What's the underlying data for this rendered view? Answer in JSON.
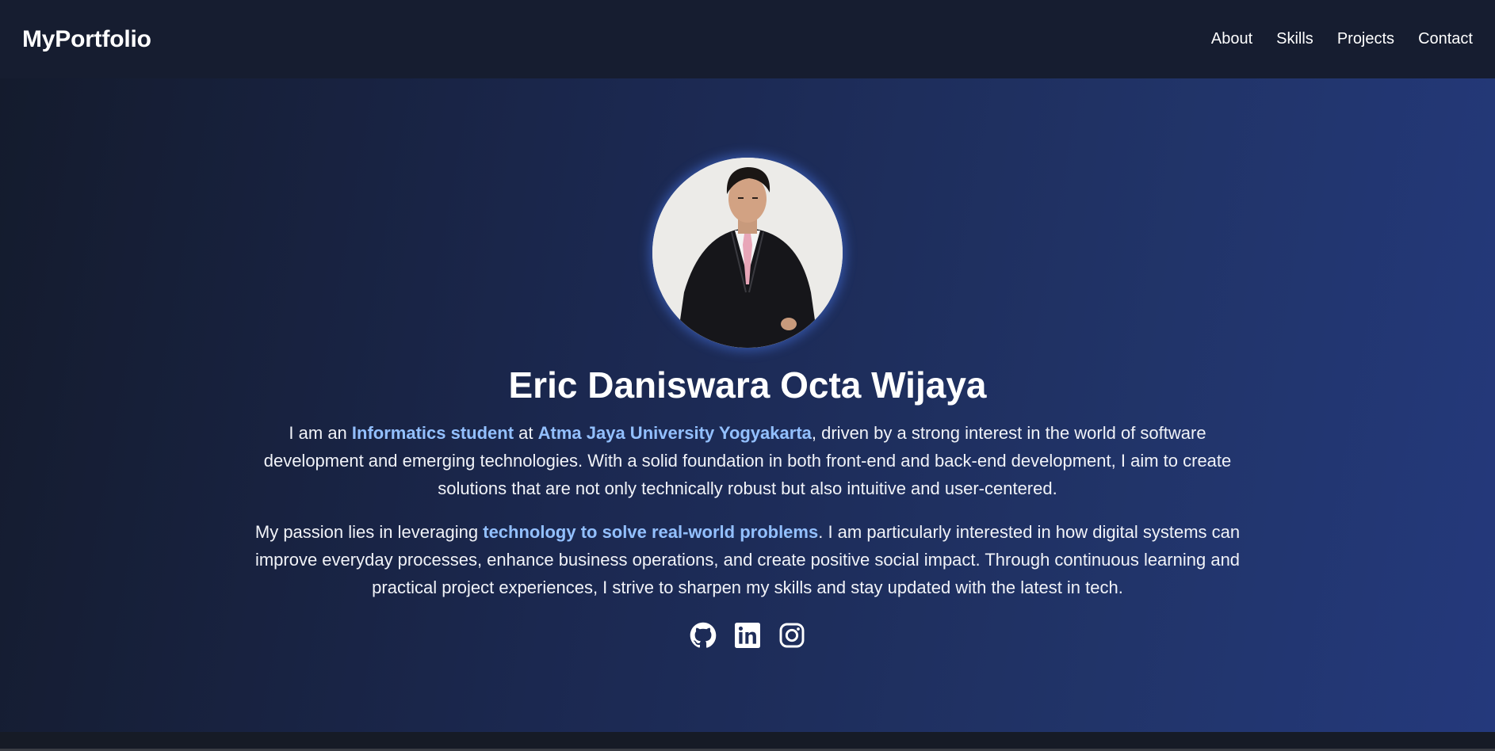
{
  "navbar": {
    "brand": "MyPortfolio",
    "links": [
      {
        "label": "About"
      },
      {
        "label": "Skills"
      },
      {
        "label": "Projects"
      },
      {
        "label": "Contact"
      }
    ]
  },
  "hero": {
    "name": "Eric Daniswara Octa Wijaya",
    "paragraph1": {
      "t1": "I am an ",
      "h1": "Informatics student",
      "t2": " at ",
      "h2": "Atma Jaya University Yogyakarta",
      "t3": ", driven by a strong interest in the world of software development and emerging technologies. With a solid foundation in both front-end and back-end development, I aim to create solutions that are not only technically robust but also intuitive and user-centered."
    },
    "paragraph2": {
      "t1": "My passion lies in leveraging ",
      "h1": "technology to solve real-world problems",
      "t2": ". I am particularly interested in how digital systems can improve everyday processes, enhance business operations, and create positive social impact. Through continuous learning and practical project experiences, I strive to sharpen my skills and stay updated with the latest in tech."
    },
    "socials": [
      {
        "icon": "github-icon"
      },
      {
        "icon": "linkedin-icon"
      },
      {
        "icon": "instagram-icon"
      }
    ]
  },
  "colors": {
    "highlight": "#93c0ff",
    "nav_background": "#161d30",
    "hero_gradient_start": "#141b2d",
    "hero_gradient_end": "#24397c"
  }
}
